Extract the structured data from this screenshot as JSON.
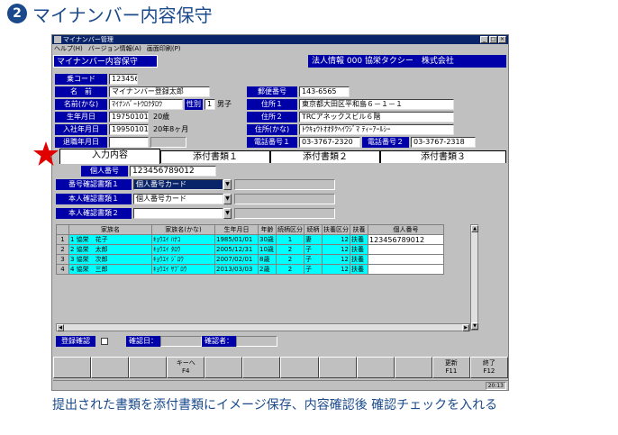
{
  "step": {
    "number": "2",
    "title": "マイナンバー内容保守"
  },
  "window": {
    "title": "マイナンバー管理",
    "menu": [
      "ヘルプ(H)",
      "バージョン情報(A)",
      "画面印刷(P)"
    ],
    "buttons": [
      "_",
      "□",
      "×"
    ]
  },
  "screen_title": "マイナンバー内容保守",
  "company": "法人情報 000 協栄タクシー　株式会社",
  "employee": {
    "code_label": "乗コード",
    "code": "123456",
    "name_label": "名　前",
    "name": "マイナンバー登録太郎",
    "kana_label": "名前(かな)",
    "kana": "ﾏｲﾅﾝﾊﾞｰﾄｳﾛｸﾀﾛｳ",
    "gender_label": "性別",
    "gender_code": "1",
    "gender": "男子",
    "birth_label": "生年月日",
    "birth": "19750101",
    "age": "20歳",
    "hire_label": "入社年月日",
    "hire": "19950101",
    "tenure": "20年8ヶ月",
    "retire_label": "退職年月日",
    "zip_label": "郵便番号",
    "zip": "143-6565",
    "addr1_label": "住所１",
    "addr1": "東京都大田区平和島６－１－１",
    "addr2_label": "住所２",
    "addr2": "TRCアネックスビル６階",
    "addr_kana_label": "住所(かな)",
    "addr_kana": "ﾄｳｷｮｳﾄｵｵﾀｸﾍｲﾜｼﾞﾏ ﾃｨｰｱｰﾙｼｰ",
    "tel1_label": "電話番号１",
    "tel1": "03-3767-2320",
    "tel2_label": "電話番号２",
    "tel2": "03-3767-2318"
  },
  "tabs": [
    "入力内容",
    "添付書類１",
    "添付書類２",
    "添付書類３"
  ],
  "form": {
    "personal_no_label": "個人番号",
    "personal_no": "123456789012",
    "doc_type1_label": "番号確認書類１",
    "doc_type1": "個人番号カード",
    "id_doc1_label": "本人確認書類１",
    "id_doc1": "個人番号カード",
    "id_doc2_label": "本人確認書類２",
    "id_doc2": ""
  },
  "table": {
    "headers": [
      "",
      "家族名",
      "家族名(かな)",
      "生年月日",
      "年齢",
      "続柄区分",
      "続柄",
      "扶養区分",
      "扶養",
      "個人番号"
    ],
    "rows": [
      {
        "no": "1",
        "name": "1 協栄　花子",
        "kana": "ｷｮｳｴｲ ﾊﾅｺ",
        "birth": "1985/01/01",
        "age": "30歳",
        "rel_code": "1",
        "rel": "妻",
        "dep_code": "12",
        "dep": "扶養",
        "pno": "123456789012"
      },
      {
        "no": "2",
        "name": "2 協栄　太郎",
        "kana": "ｷｮｳｴｲ ﾀﾛｳ",
        "birth": "2005/12/31",
        "age": "10歳",
        "rel_code": "2",
        "rel": "子",
        "dep_code": "12",
        "dep": "扶養",
        "pno": ""
      },
      {
        "no": "3",
        "name": "3 協栄　次郎",
        "kana": "ｷｮｳｴｲ ｼﾞﾛｳ",
        "birth": "2007/02/01",
        "age": "8歳",
        "rel_code": "2",
        "rel": "子",
        "dep_code": "12",
        "dep": "扶養",
        "pno": ""
      },
      {
        "no": "4",
        "name": "4 協栄　三郎",
        "kana": "ｷｮｳｴｲ ｻﾌﾞﾛｳ",
        "birth": "2013/03/03",
        "age": "2歳",
        "rel_code": "2",
        "rel": "子",
        "dep_code": "12",
        "dep": "扶養",
        "pno": ""
      }
    ]
  },
  "footer": {
    "check_label": "登録確認",
    "check_state": false,
    "confirm_date_label": "確認日：",
    "register_date_label": "確認者："
  },
  "fkeys": [
    {
      "label": "",
      "key": ""
    },
    {
      "label": "",
      "key": ""
    },
    {
      "label": "",
      "key": ""
    },
    {
      "label": "キーへ",
      "key": "F4"
    },
    {
      "label": "",
      "key": ""
    },
    {
      "label": "",
      "key": ""
    },
    {
      "label": "",
      "key": ""
    },
    {
      "label": "",
      "key": ""
    },
    {
      "label": "",
      "key": ""
    },
    {
      "label": "",
      "key": ""
    },
    {
      "label": "更新",
      "key": "F11"
    },
    {
      "label": "終了",
      "key": "F12"
    }
  ],
  "clock": "20:13",
  "caption": "提出された書類を添付書類にイメージ保存、内容確認後 確認チェックを入れる",
  "colors": {
    "accent": "#1a4a8c",
    "star": "#e00000",
    "grid_highlight": "#00ffff"
  }
}
